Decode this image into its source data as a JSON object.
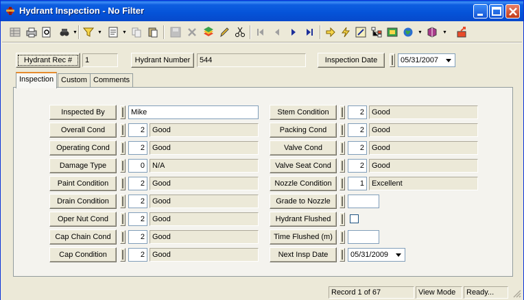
{
  "window": {
    "title": "Hydrant Inspection - No Filter"
  },
  "toolbar": {
    "icons": [
      "grid-icon",
      "print-icon",
      "preview-icon",
      "binoculars-icon",
      "filter-icon",
      "report-icon",
      "copy-icon",
      "paste-icon",
      "save-icon",
      "delete-icon",
      "stack-icon",
      "edit-icon",
      "cut-icon",
      "first-record-icon",
      "prev-record-icon",
      "next-record-icon",
      "last-record-icon",
      "arrow-right-icon",
      "lightning-icon",
      "tool-icon",
      "tree-icon",
      "map-icon",
      "globe-icon",
      "book-icon",
      "exit-icon"
    ]
  },
  "header": {
    "rec_label": "Hydrant Rec #",
    "rec_value": "1",
    "number_label": "Hydrant Number",
    "number_value": "544",
    "date_label": "Inspection Date",
    "date_value": "05/31/2007"
  },
  "tabs": [
    {
      "label": "Inspection"
    },
    {
      "label": "Custom"
    },
    {
      "label": "Comments"
    }
  ],
  "left_fields": [
    {
      "label": "Inspected By",
      "code": "",
      "value": "Mike"
    },
    {
      "label": "Overall Cond",
      "code": "2",
      "value": "Good"
    },
    {
      "label": "Operating Cond",
      "code": "2",
      "value": "Good"
    },
    {
      "label": "Damage Type",
      "code": "0",
      "value": "N/A"
    },
    {
      "label": "Paint Condition",
      "code": "2",
      "value": "Good"
    },
    {
      "label": "Drain Condition",
      "code": "2",
      "value": "Good"
    },
    {
      "label": "Oper Nut Cond",
      "code": "2",
      "value": "Good"
    },
    {
      "label": "Cap Chain Cond",
      "code": "2",
      "value": "Good"
    },
    {
      "label": "Cap Condition",
      "code": "2",
      "value": "Good"
    }
  ],
  "right_fields": [
    {
      "label": "Stem Condition",
      "code": "2",
      "value": "Good"
    },
    {
      "label": "Packing Cond",
      "code": "2",
      "value": "Good"
    },
    {
      "label": "Valve Cond",
      "code": "2",
      "value": "Good"
    },
    {
      "label": "Valve Seat Cond",
      "code": "2",
      "value": "Good"
    },
    {
      "label": "Nozzle Condition",
      "code": "1",
      "value": "Excellent"
    },
    {
      "label": "Grade to Nozzle",
      "value": ""
    },
    {
      "label": "Hydrant Flushed",
      "checked": false
    },
    {
      "label": "Time Flushed (m)",
      "value": ""
    },
    {
      "label": "Next Insp Date",
      "value": "05/31/2009"
    }
  ],
  "status": {
    "record": "Record 1 of 67",
    "mode": "View Mode",
    "state": "Ready..."
  },
  "colors": {
    "titlebar": "#0553d8",
    "face": "#ece9d8",
    "tab_accent": "#e68b2c"
  }
}
